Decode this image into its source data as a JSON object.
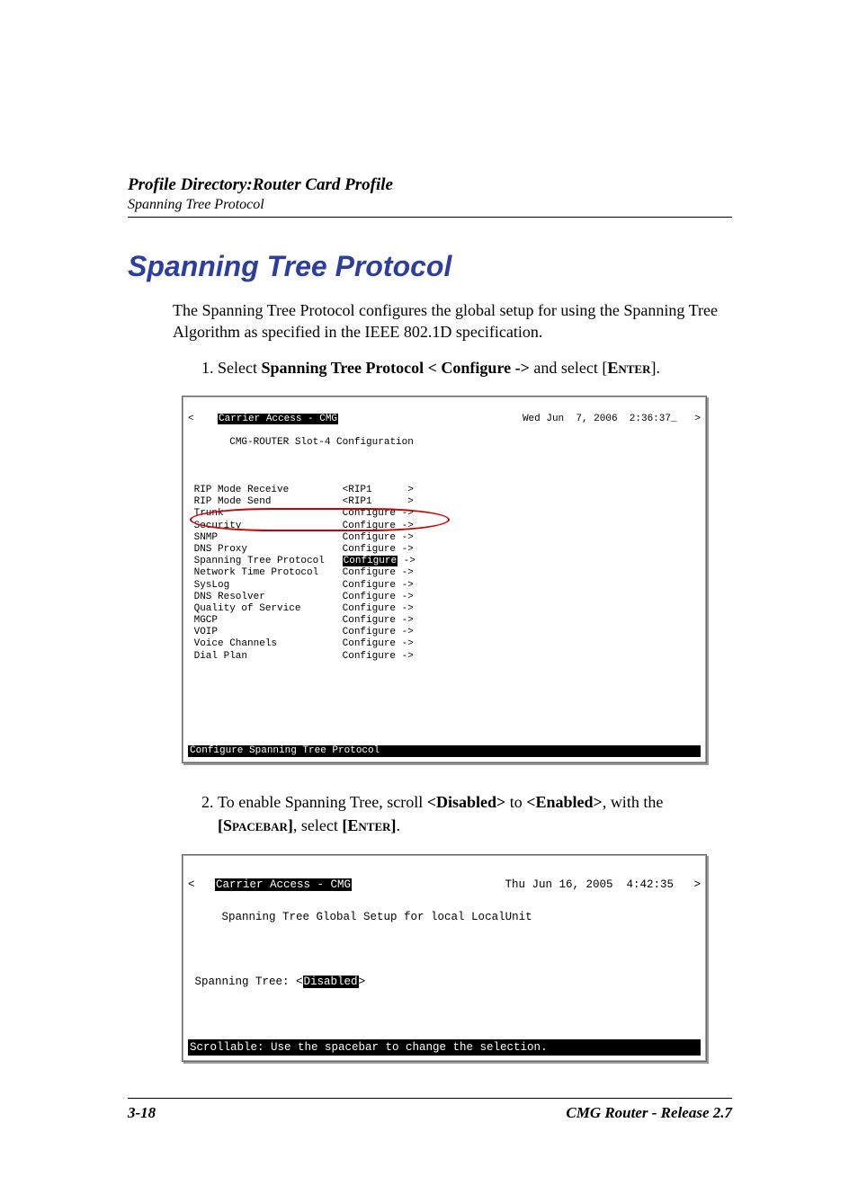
{
  "header": {
    "title": "Profile Directory:Router Card Profile",
    "subtitle": "Spanning Tree Protocol"
  },
  "section": {
    "heading": "Spanning Tree Protocol",
    "intro": "The Spanning Tree Protocol configures the global setup for using the Spanning Tree Algorithm as specified in the IEEE 802.1D specification."
  },
  "steps": {
    "s1_pre": "Select ",
    "s1_bold": "Spanning Tree Protocol < Configure ->",
    "s1_mid": " and select [",
    "s1_key": "Enter",
    "s1_post": "].",
    "s2_pre": "To enable Spanning Tree, scroll ",
    "s2_b1": "<Disabled>",
    "s2_mid1": " to ",
    "s2_b2": "<Enabled>",
    "s2_mid2": ", with the ",
    "s2_b3a": "[",
    "s2_key1": "Spacebar",
    "s2_b3b": "]",
    "s2_mid3": ", select ",
    "s2_b4a": "[",
    "s2_key2": "Enter",
    "s2_b4b": "]",
    "s2_post": "."
  },
  "term1": {
    "title_inv": "Carrier Access - CMG",
    "datetime": "Wed Jun  7, 2006  2:36:37_",
    "subtitle": "CMG-ROUTER Slot-4 Configuration",
    "rows": [
      {
        "l": "RIP Mode Receive",
        "r": "<RIP1      >"
      },
      {
        "l": "RIP Mode Send",
        "r": "<RIP1      >"
      },
      {
        "l": "Trunk",
        "r": "Configure ->"
      },
      {
        "l": "Security",
        "r": "Configure ->"
      },
      {
        "l": "SNMP",
        "r": "Configure ->"
      },
      {
        "l": "DNS Proxy",
        "r": "Configure ->"
      },
      {
        "l": "Spanning Tree Protocol",
        "r_inv": "Configure",
        "r_suffix": " ->"
      },
      {
        "l": "Network Time Protocol",
        "r": "Configure ->"
      },
      {
        "l": "SysLog",
        "r": "Configure ->"
      },
      {
        "l": "DNS Resolver",
        "r": "Configure ->"
      },
      {
        "l": "Quality of Service",
        "r": "Configure ->"
      },
      {
        "l": "MGCP",
        "r": "Configure ->"
      },
      {
        "l": "VOIP",
        "r": "Configure ->"
      },
      {
        "l": "Voice Channels",
        "r": "Configure ->"
      },
      {
        "l": "Dial Plan",
        "r": "Configure ->"
      }
    ],
    "status_bar": "Configure Spanning Tree Protocol                                          "
  },
  "term2": {
    "title_inv": "Carrier Access - CMG",
    "datetime": "Thu Jun 16, 2005  4:42:35",
    "subtitle": "Spanning Tree Global Setup for local LocalUnit",
    "field_label": "Spanning Tree: <",
    "field_value_inv": "Disabled",
    "field_post": ">",
    "status_bar": "Scrollable: Use the spacebar to change the selection.                  "
  },
  "footer": {
    "page": "3-18",
    "doc": "CMG Router - Release 2.7"
  }
}
